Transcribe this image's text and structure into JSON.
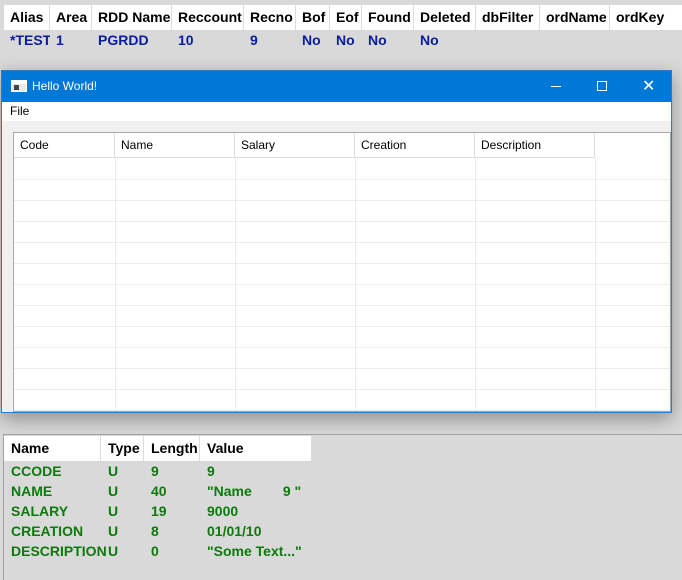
{
  "workarea": {
    "columns": [
      "Alias",
      "Area",
      "RDD Name",
      "Reccount",
      "Recno",
      "Bof",
      "Eof",
      "Found",
      "Deleted",
      "dbFilter",
      "ordName",
      "ordKey"
    ],
    "row": [
      "*TEST",
      "1",
      "PGRDD",
      "10",
      "9",
      "No",
      "No",
      "No",
      "No",
      "",
      "",
      ""
    ]
  },
  "dialog": {
    "title": "Hello World!",
    "menu": [
      "File"
    ],
    "grid_columns": [
      "Code",
      "Name",
      "Salary",
      "Creation",
      "Description"
    ],
    "buttons": {
      "minimize": "minimize-icon",
      "maximize": "maximize-icon",
      "close": "close-icon"
    },
    "accent": "#0078d7"
  },
  "fields": {
    "columns": [
      "Name",
      "Type",
      "Length",
      "Value"
    ],
    "rows": [
      [
        "CCODE",
        "U",
        "9",
        "9"
      ],
      [
        "NAME",
        "U",
        "40",
        "\"Name        9 \""
      ],
      [
        "SALARY",
        "U",
        "19",
        "9000"
      ],
      [
        "CREATION",
        "U",
        "8",
        "01/01/10"
      ],
      [
        "DESCRIPTION",
        "U",
        "0",
        "\"Some Text...\""
      ]
    ],
    "text_color": "#0b7a0b"
  },
  "workarea_text_color": "#0a1d9c"
}
